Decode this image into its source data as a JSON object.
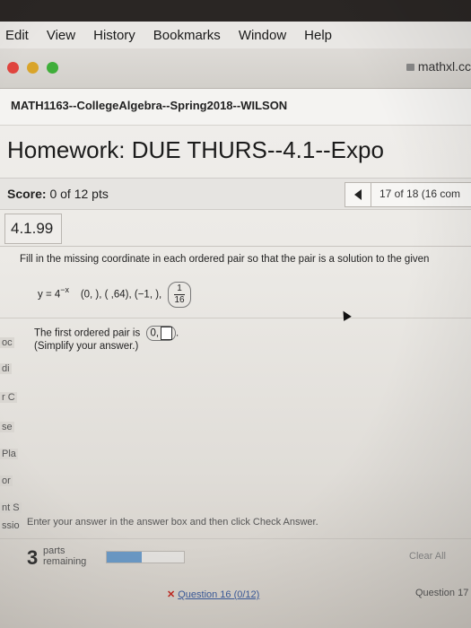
{
  "menu": [
    "Edit",
    "View",
    "History",
    "Bookmarks",
    "Window",
    "Help"
  ],
  "browser": {
    "url": "mathxl.cc",
    "traffic_colors": [
      "#e0443e",
      "#d9a42a",
      "#3fae3a"
    ]
  },
  "course": {
    "title": "MATH1163--CollegeAlgebra--Spring2018--WILSON"
  },
  "homework": {
    "title": "Homework: DUE THURS--4.1--Expo"
  },
  "score": {
    "label": "Score:",
    "value": "0 of 12 pts"
  },
  "question_nav": {
    "position": "17 of 18 (16 com"
  },
  "question": {
    "id": "4.1.99",
    "instruction": "Fill in the missing coordinate in each ordered pair so that the pair is a solution to the given",
    "equation_base": "y = 4",
    "equation_exp": "−x",
    "pairs_text": "(0,  ), (  ,64), (−1,  ),",
    "frac_num": "1",
    "frac_den": "16",
    "answer_prompt": "The first ordered pair is",
    "answer_pair_x": "0,",
    "answer_hint": "(Simplify your answer.)"
  },
  "left_fragments": [
    "oc",
    "di",
    "r C",
    "se",
    "Pla",
    "or",
    "nt S",
    "ssio"
  ],
  "footer": {
    "message": "Enter your answer in the answer box and then click Check Answer.",
    "parts_count": "3",
    "parts_label_1": "parts",
    "parts_label_2": "remaining",
    "progress_fraction": 0.45,
    "clear_all": "Clear All",
    "prev_question": "Question 16 (0/12)",
    "next_question": "Question 17"
  }
}
